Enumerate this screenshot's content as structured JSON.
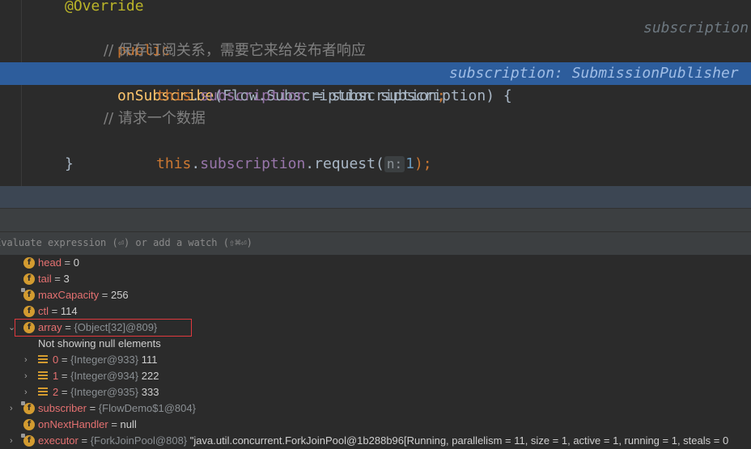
{
  "editor": {
    "annotation": "@Override",
    "kw_public": "public",
    "kw_void": "void",
    "method_name": "onSubscribe",
    "param_sig": "(Flow.Subscription subscription) {",
    "inline_hint_1": "subscription",
    "comment_1": "// 保存订阅关系，需要它来给发布者响应",
    "kw_this": "this",
    "dot": ".",
    "field_subscription": "subscription",
    "assign_rest": " = subscription",
    "semicolon": ";",
    "inline_hint_2": "subscription: SubmissionPublisher",
    "comment_2": "// 请求一个数据",
    "call_request": ".request(",
    "param_hint_n": "n:",
    "arg_1": "1",
    "call_end": ");",
    "close_brace": "}"
  },
  "evaluate_bar": {
    "placeholder": "Evaluate expression (⏎) or add a watch (⇧⌘⏎)"
  },
  "variables": [
    {
      "name": "head",
      "eq": " = ",
      "value": "0"
    },
    {
      "name": "tail",
      "eq": " = ",
      "value": "3"
    },
    {
      "name": "maxCapacity",
      "eq": " = ",
      "value": "256"
    },
    {
      "name": "ctl",
      "eq": " = ",
      "value": "114"
    },
    {
      "name": "array",
      "eq": " = ",
      "type_value": "{Object[32]@809}"
    },
    {
      "text": "Not showing null elements"
    },
    {
      "name": "0",
      "eq": " = ",
      "type_value": "{Integer@933}",
      "value": "111"
    },
    {
      "name": "1",
      "eq": " = ",
      "type_value": "{Integer@934}",
      "value": "222"
    },
    {
      "name": "2",
      "eq": " = ",
      "type_value": "{Integer@935}",
      "value": "333"
    },
    {
      "name": "subscriber",
      "eq": " = ",
      "type_value": "{FlowDemo$1@804}"
    },
    {
      "name": "onNextHandler",
      "eq": " = ",
      "value": "null"
    },
    {
      "name": "executor",
      "eq": " = ",
      "type_value": "{ForkJoinPool@808}",
      "value": "\"java.util.concurrent.ForkJoinPool@1b288b96[Running, parallelism = 11, size = 1, active = 1, running = 1, steals = 0"
    }
  ],
  "colors": {
    "selected_line": "#2d5d9c",
    "field_icon": "#d39b30",
    "var_name": "#e57171",
    "highlight_box": "#e0393e"
  }
}
